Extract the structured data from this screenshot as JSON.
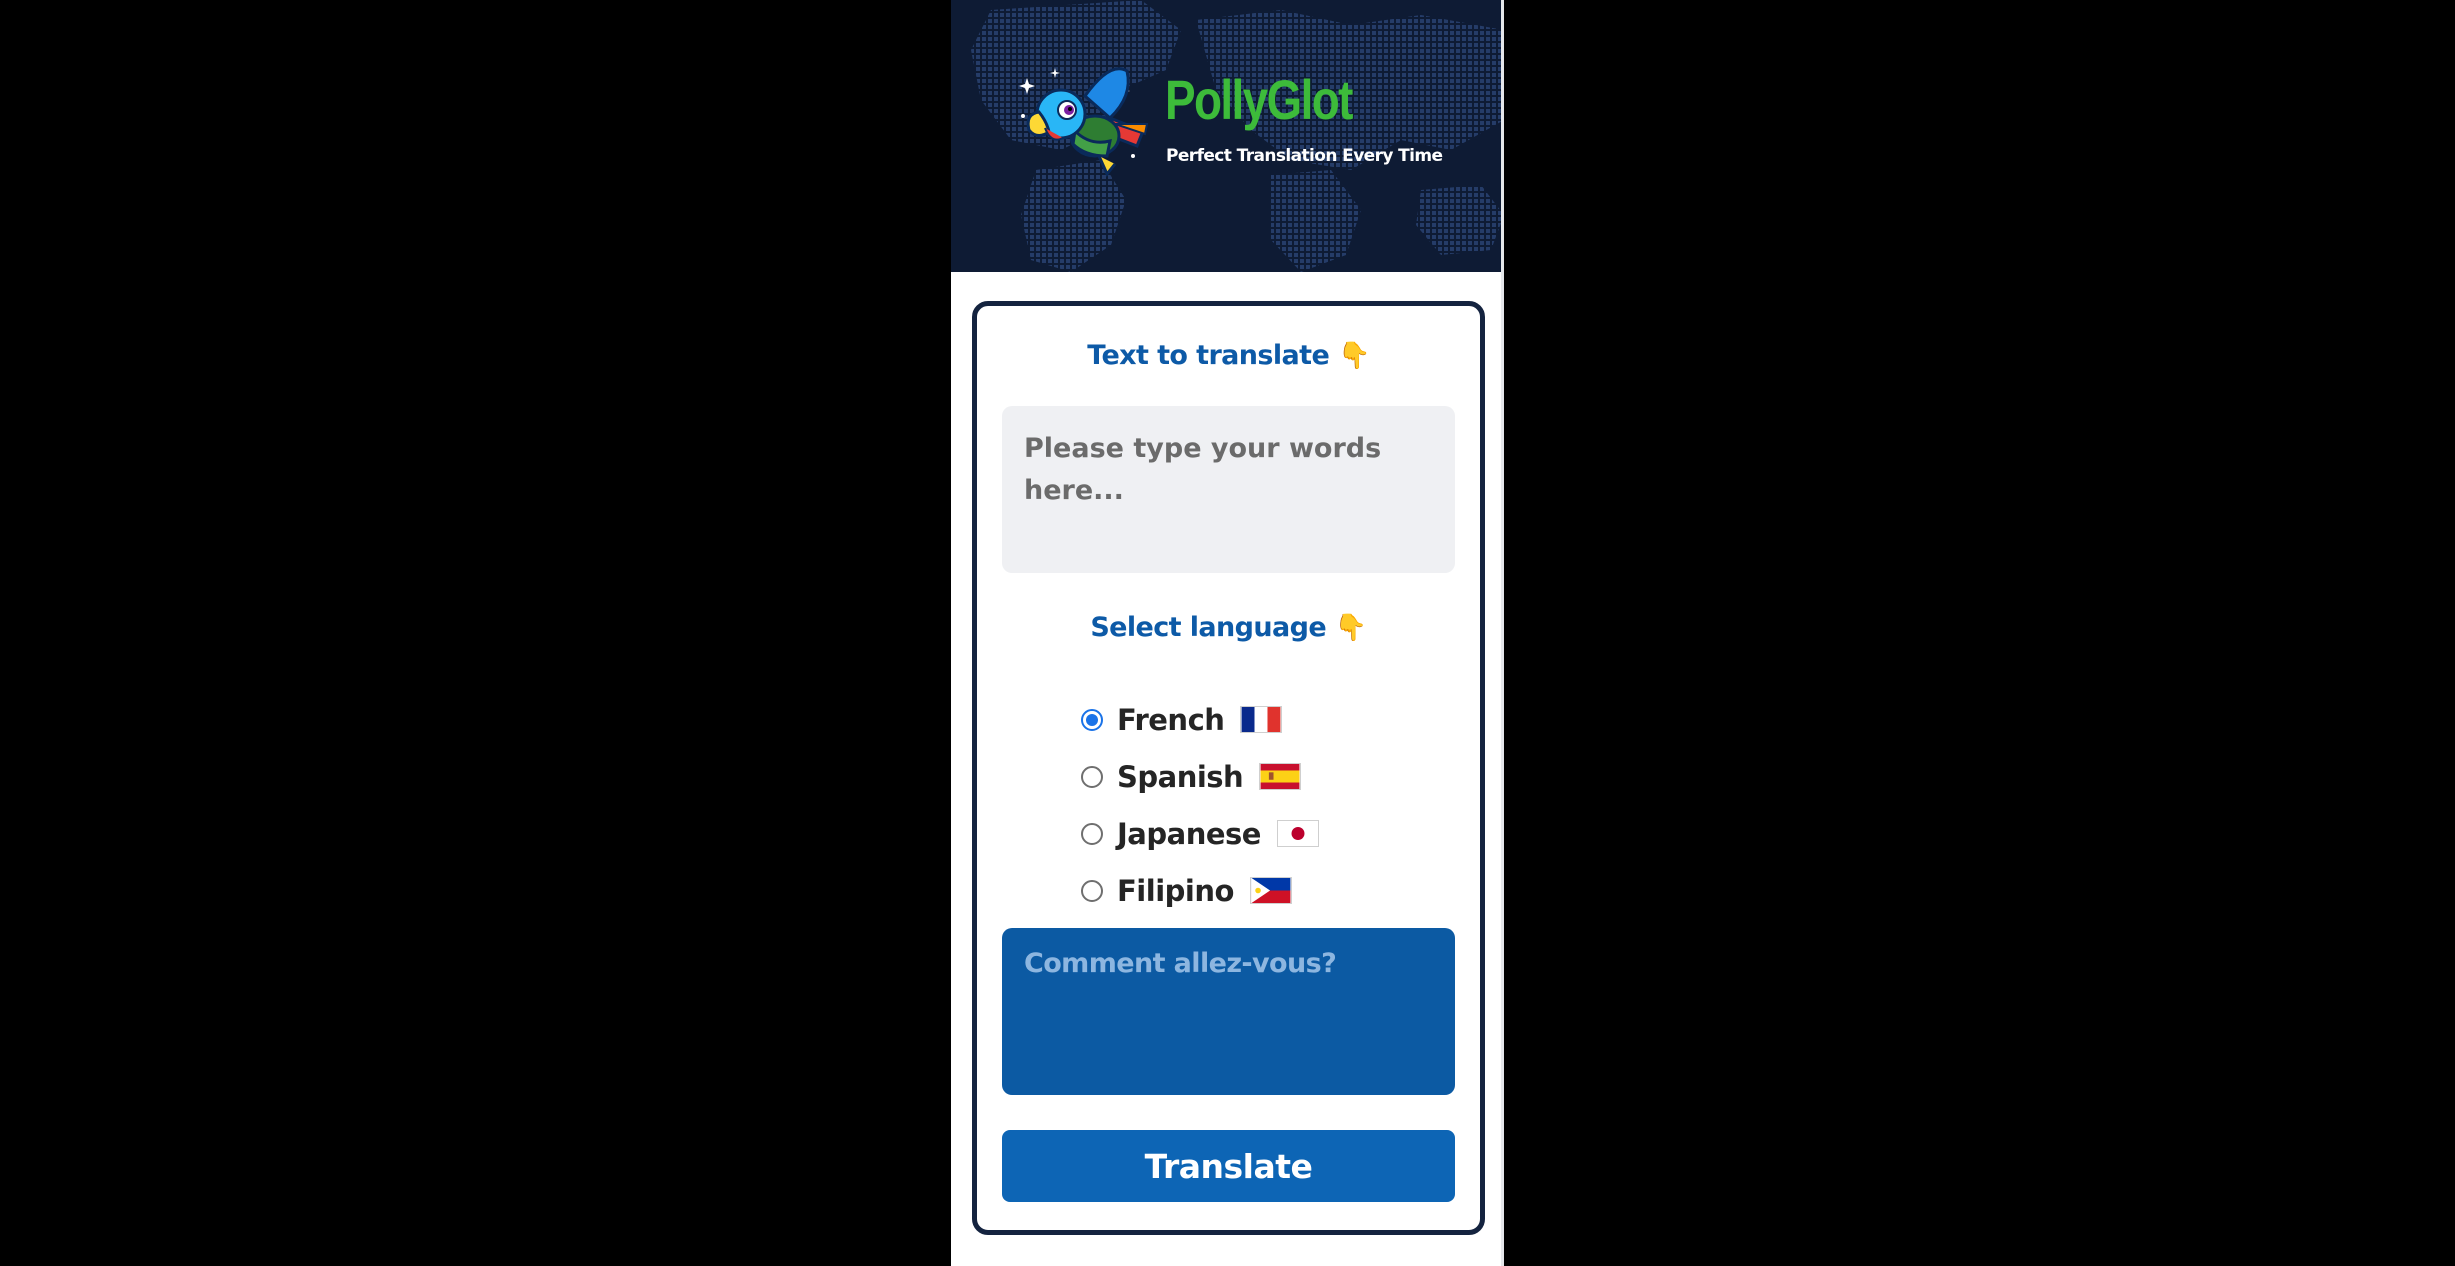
{
  "header": {
    "brand_title": "PollyGlot",
    "tagline": "Perfect Translation Every Time",
    "logo_icon": "parrot-logo-icon"
  },
  "input_section": {
    "heading": "Text to translate",
    "heading_emoji": "👇",
    "placeholder": "Please type your words here..."
  },
  "language_section": {
    "heading": "Select language",
    "heading_emoji": "👇",
    "selected": "French",
    "options": [
      {
        "label": "French",
        "flag": "france-flag-icon"
      },
      {
        "label": "Spanish",
        "flag": "spain-flag-icon"
      },
      {
        "label": "Japanese",
        "flag": "japan-flag-icon"
      },
      {
        "label": "Filipino",
        "flag": "philippines-flag-icon"
      }
    ]
  },
  "output": {
    "text": "Comment allez-vous?"
  },
  "actions": {
    "translate_label": "Translate"
  },
  "colors": {
    "page_background": "#000000",
    "header_background": "#0e1b34",
    "brand_green": "#3dbb3a",
    "heading_blue": "#0d5aa7",
    "output_background": "#0c5aa3",
    "button_background": "#0d65b5",
    "card_border": "#14233f"
  }
}
